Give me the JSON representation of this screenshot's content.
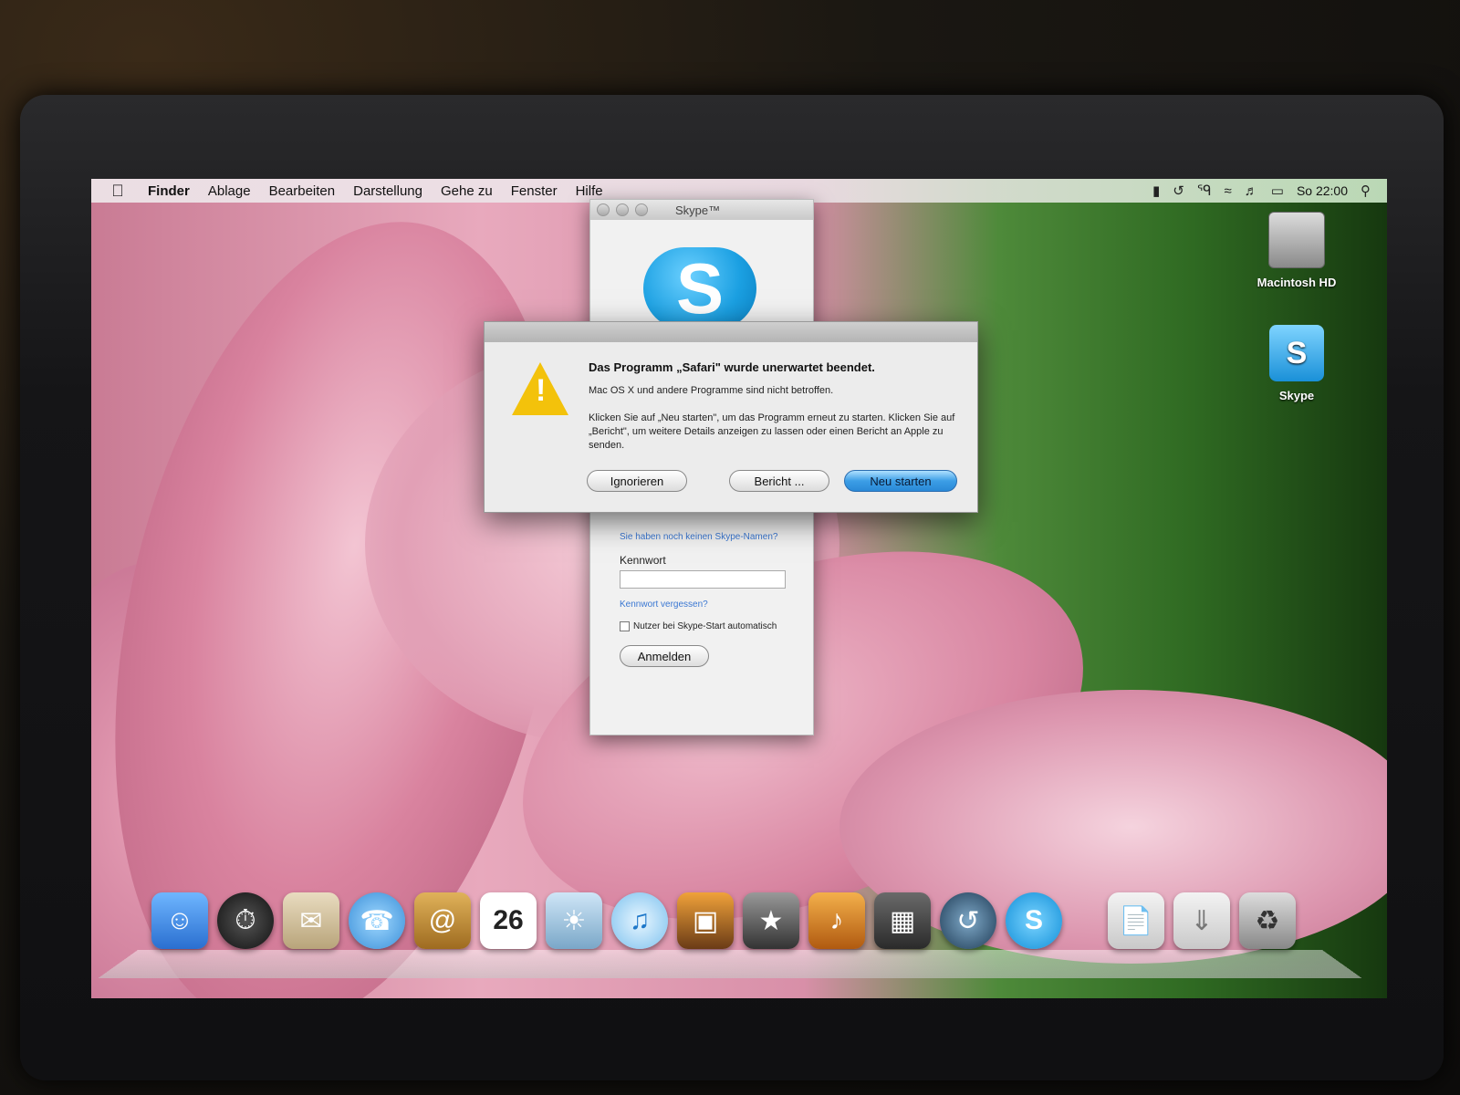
{
  "menubar": {
    "apple_icon": "apple-icon",
    "items": [
      "Finder",
      "Ablage",
      "Bearbeiten",
      "Darstellung",
      "Gehe zu",
      "Fenster",
      "Hilfe"
    ],
    "clock": "So 22:00",
    "status_icons": [
      "extras-icon",
      "time-machine-icon",
      "bluetooth-icon",
      "wifi-icon",
      "volume-icon",
      "battery-icon",
      "spotlight-icon"
    ]
  },
  "skype_window": {
    "title": "Skype™",
    "no_name_link": "Sie haben noch keinen Skype-Namen?",
    "password_label": "Kennwort",
    "forgot_link": "Kennwort vergessen?",
    "auto_login_label": "Nutzer bei Skype-Start automatisch",
    "login_button": "Anmelden"
  },
  "alert": {
    "title": "Das Programm „Safari\" wurde unerwartet beendet.",
    "line1": "Mac OS X und andere Programme sind nicht betroffen.",
    "line2": "Klicken Sie auf „Neu starten\", um das Programm erneut zu starten. Klicken Sie auf „Bericht\", um weitere Details anzeigen zu lassen oder einen Bericht an Apple zu senden.",
    "ignore_button": "Ignorieren",
    "report_button": "Bericht ...",
    "restart_button": "Neu starten"
  },
  "desktop": {
    "icons": [
      {
        "label": "Macintosh HD",
        "icon": "hard-drive-icon"
      },
      {
        "label": "Skype",
        "icon": "skype-disk-icon"
      }
    ]
  },
  "dock": {
    "calendar_day": "26",
    "icons": [
      "finder-icon",
      "dashboard-icon",
      "mail-icon",
      "ichat-icon",
      "address-book-icon",
      "ical-icon",
      "iphoto-icon",
      "itunes-icon",
      "photo-booth-icon",
      "imovie-icon",
      "garageband-icon",
      "spaces-icon",
      "time-machine-icon",
      "skype-icon",
      "documents-icon",
      "downloads-icon",
      "trash-icon"
    ]
  }
}
